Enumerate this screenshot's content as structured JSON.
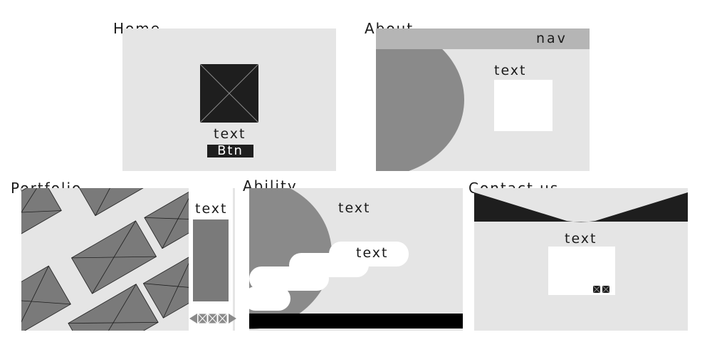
{
  "home": {
    "title": "Home",
    "text": "text",
    "button": "Btn"
  },
  "about": {
    "title": "About",
    "nav": "nav",
    "text": "text"
  },
  "portfolio": {
    "title": "Portfolio",
    "text": "text"
  },
  "ability": {
    "title": "Ability",
    "text_top": "text",
    "text_bubble": "text"
  },
  "contact": {
    "title": "Contact us",
    "text": "text"
  },
  "colors": {
    "panel": "#e5e5e5",
    "dark": "#1e1e1e",
    "mid_gray": "#8a8a8a",
    "nav_gray": "#b5b5b5",
    "black": "#000000",
    "white": "#ffffff"
  }
}
